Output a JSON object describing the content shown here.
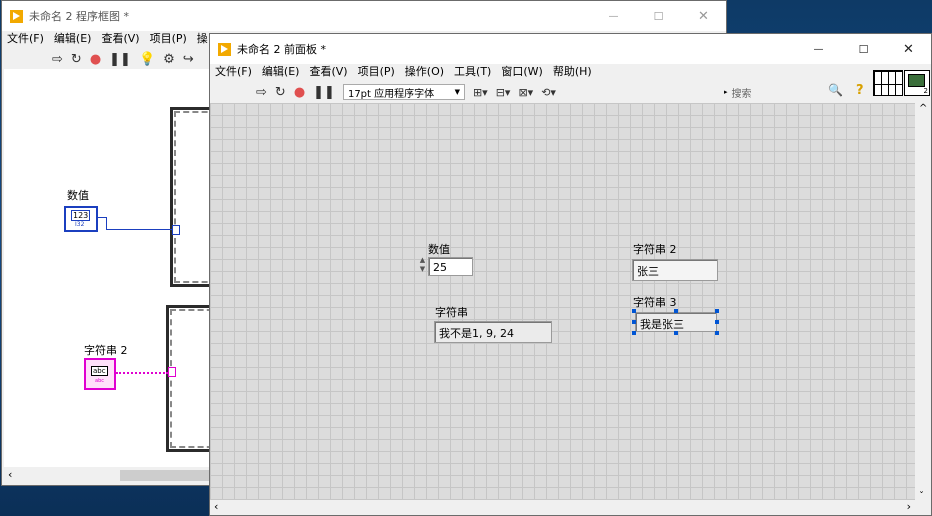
{
  "block_window": {
    "title": "未命名 2 程序框图 *",
    "menu": [
      "文件(F)",
      "编辑(E)",
      "查看(V)",
      "项目(P)",
      "操"
    ],
    "numeric_label": "数值",
    "numeric_terminal_text": "123",
    "numeric_terminal_sub": "I32",
    "string_label": "字符串 2",
    "string_terminal_text": "abc",
    "string_terminal_sub": "abc"
  },
  "front_window": {
    "title": "未命名 2 前面板 *",
    "menu": [
      "文件(F)",
      "编辑(E)",
      "查看(V)",
      "项目(P)",
      "操作(O)",
      "工具(T)",
      "窗口(W)",
      "帮助(H)"
    ],
    "font_selector": "17pt 应用程序字体",
    "search_placeholder": "搜索",
    "help_glyph": "?",
    "connector_number": "2"
  },
  "controls": {
    "numeric": {
      "label": "数值",
      "value": "25"
    },
    "string": {
      "label": "字符串",
      "value": "我不是1, 9, 24"
    },
    "string2": {
      "label": "字符串 2",
      "value": "张三"
    },
    "string3": {
      "label": "字符串 3",
      "value": "我是张三"
    }
  },
  "window_buttons": {
    "minimize": "—",
    "maximize": "☐",
    "close": "✕"
  },
  "colors": {
    "numeric_wire": "#1b3fbf",
    "string_wire": "#e000d0",
    "lv_accent": "#f2a900"
  }
}
